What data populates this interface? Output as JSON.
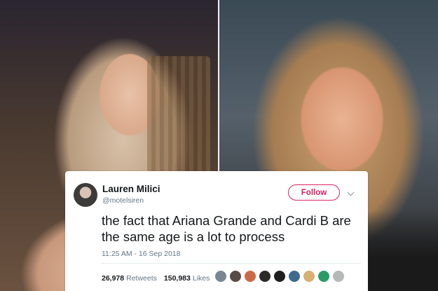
{
  "tweet": {
    "display_name": "Lauren Milici",
    "handle": "@motelsiren",
    "follow_label": "Follow",
    "text": "the fact that Ariana Grande and Cardi B are the same age is a lot to process",
    "timestamp": "11:25 AM - 16 Sep 2018",
    "retweets_count": "26,978",
    "retweets_label": "Retweets",
    "likes_count": "150,983",
    "likes_label": "Likes",
    "accent_color": "#e0245e"
  },
  "icons": {
    "more": "chevron-down-icon"
  },
  "likers": [
    {
      "color": "#7a8790"
    },
    {
      "color": "#5a4a45"
    },
    {
      "color": "#c96b4a"
    },
    {
      "color": "#2a2a2a"
    },
    {
      "color": "#1f1f1f"
    },
    {
      "color": "#3e6b8c"
    },
    {
      "color": "#d8b070"
    },
    {
      "color": "#2b9a68"
    },
    {
      "color": "#b8b8b8"
    }
  ]
}
